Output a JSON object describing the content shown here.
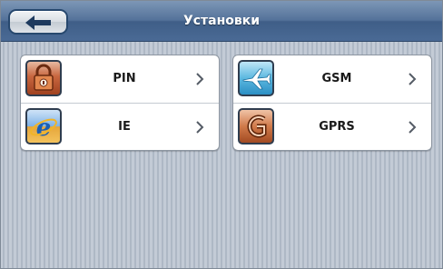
{
  "header": {
    "title": "Установки",
    "back_icon": "back-arrow-icon"
  },
  "left_panel": {
    "items": [
      {
        "label": "PIN",
        "icon": "padlock-icon"
      },
      {
        "label": "IE",
        "icon": "internet-explorer-icon"
      }
    ]
  },
  "right_panel": {
    "items": [
      {
        "label": "GSM",
        "icon": "airplane-icon"
      },
      {
        "label": "GPRS",
        "icon": "gprs-icon"
      }
    ]
  },
  "colors": {
    "header": "#54729a",
    "background_stripe_light": "#c3cbd6",
    "background_stripe_dark": "#aeb8c5"
  }
}
